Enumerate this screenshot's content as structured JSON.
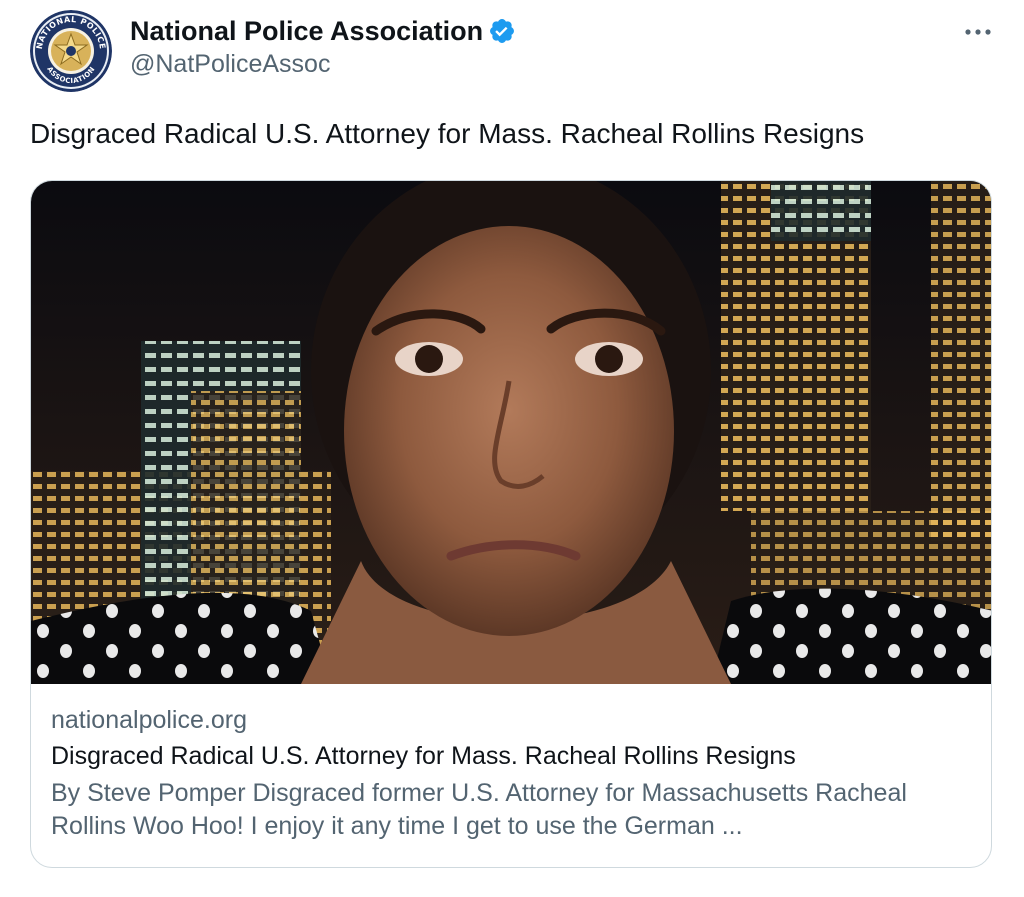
{
  "account": {
    "display_name": "National Police Association",
    "handle": "@NatPoliceAssoc",
    "verified": true,
    "avatar_text_top": "NATIONAL POLICE",
    "avatar_text_bottom": "ASSOCIATION"
  },
  "tweet": {
    "text": "Disgraced Radical U.S. Attorney for Mass. Racheal Rollins Resigns"
  },
  "card": {
    "domain": "nationalpolice.org",
    "title": "Disgraced Radical U.S. Attorney for Mass. Racheal Rollins Resigns",
    "description": "By Steve Pomper Disgraced former U.S. Attorney for Massachusetts Racheal Rollins Woo Hoo! I enjoy it any time I get to use the German ..."
  },
  "icons": {
    "verified": "verified-badge-icon",
    "more": "more-options-icon"
  },
  "colors": {
    "verified_blue": "#1d9bf0",
    "secondary_text": "#536471",
    "primary_text": "#0f1419",
    "border": "#cfd9de"
  }
}
